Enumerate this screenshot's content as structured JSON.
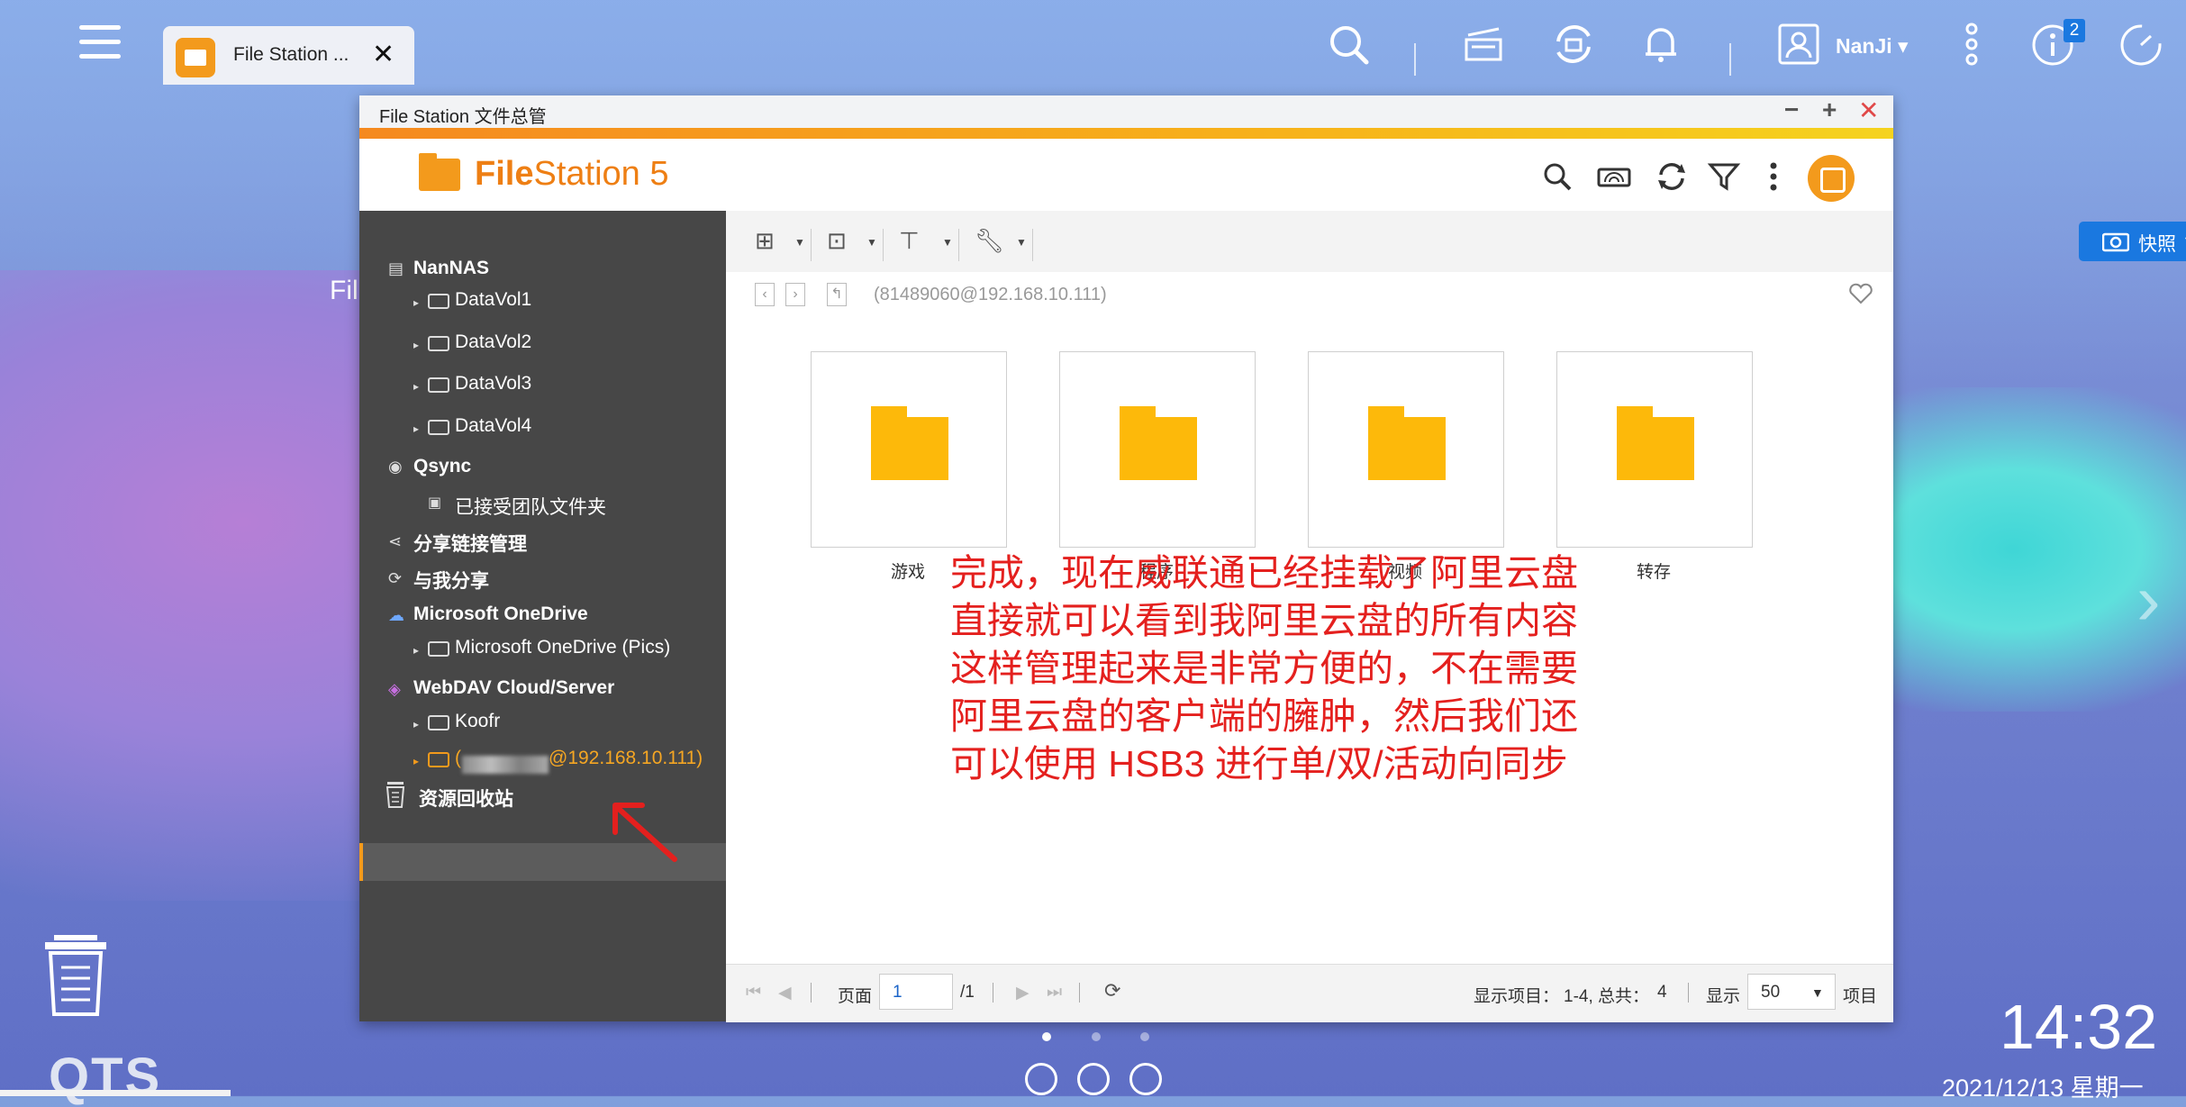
{
  "taskbar": {
    "tab_label": "File Station ...",
    "tab_close": "✕",
    "user_name": "NanJi",
    "user_caret": "▾",
    "notification_count": "2"
  },
  "window": {
    "title": "File Station 文件总管",
    "app_name_bold": "File",
    "app_name_rest": "Station 5"
  },
  "sidebar": {
    "items": [
      {
        "label": "NanNAS"
      },
      {
        "label": "DataVol1"
      },
      {
        "label": "DataVol2"
      },
      {
        "label": "DataVol3"
      },
      {
        "label": "DataVol4"
      },
      {
        "label": "Qsync"
      },
      {
        "label": "已接受团队文件夹"
      },
      {
        "label": "分享链接管理"
      },
      {
        "label": "与我分享"
      },
      {
        "label": "Microsoft OneDrive"
      },
      {
        "label": "Microsoft OneDrive (Pics)"
      },
      {
        "label": "WebDAV Cloud/Server"
      },
      {
        "label": "Koofr"
      },
      {
        "label_prefix": "(",
        "label": "@192.168.10.111)"
      },
      {
        "label": "资源回收站"
      }
    ]
  },
  "toolbar": {
    "snapshot_label": "快照",
    "snapshot_caret": "▾"
  },
  "path": "(81489060@192.168.10.111)",
  "folders": [
    {
      "label": "游戏"
    },
    {
      "label": "程序"
    },
    {
      "label": "视频"
    },
    {
      "label": "转存"
    }
  ],
  "annotation_lines": [
    "完成，现在威联通已经挂载了阿里云盘",
    "直接就可以看到我阿里云盘的所有内容",
    "这样管理起来是非常方便的，不在需要",
    "阿里云盘的客户端的臃肿，然后我们还",
    "可以使用 HSB3 进行单/双/活动向同步"
  ],
  "statusbar": {
    "page_label": "页面",
    "page_value": "1",
    "page_total": "/1",
    "display_items_label": "显示项目：",
    "display_items_value": "1-4, 总共：",
    "total_count": "4",
    "show_label": "显示",
    "per_page_value": "50",
    "items_label": "项目"
  },
  "desktop": {
    "fil_label": "Fil",
    "qts_label": "QTS",
    "time": "14:32",
    "date": "2021/12/13 星期一"
  },
  "colors": {
    "accent_orange": "#f39a1c",
    "snapshot_blue": "#1a78e0",
    "annotation_red": "#e4201e",
    "sidebar_bg": "#474747",
    "folder_yellow": "#fdb90a"
  }
}
